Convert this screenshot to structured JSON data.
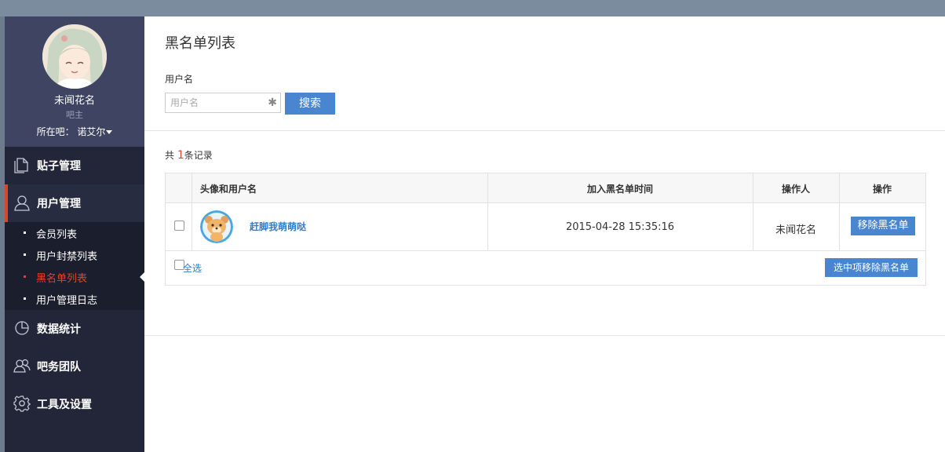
{
  "profile": {
    "name": "未闻花名",
    "role": "吧主",
    "bar_label": "所在吧：",
    "bar_name": "诺艾尔"
  },
  "nav": [
    {
      "label": "贴子管理",
      "icon": "document-icon"
    },
    {
      "label": "用户管理",
      "icon": "user-icon"
    },
    {
      "label": "数据统计",
      "icon": "pie-chart-icon"
    },
    {
      "label": "吧务团队",
      "icon": "team-icon"
    },
    {
      "label": "工具及设置",
      "icon": "gear-icon"
    }
  ],
  "subnav": [
    "会员列表",
    "用户封禁列表",
    "黑名单列表",
    "用户管理日志"
  ],
  "page": {
    "title": "黑名单列表"
  },
  "search": {
    "label": "用户名",
    "placeholder": "用户名",
    "clear_icon": "✱",
    "button": "搜索"
  },
  "records": {
    "prefix": "共",
    "count": "1",
    "suffix": "条记录"
  },
  "table": {
    "headers": [
      "头像和用户名",
      "加入黑名单时间",
      "操作人",
      "操作"
    ],
    "rows": [
      {
        "username": "赶脚我萌萌哒",
        "time": "2015-04-28 15:35:16",
        "operator": "未闻花名",
        "action": "移除黑名单"
      }
    ],
    "select_all": "全选",
    "bulk_action": "选中项移除黑名单"
  },
  "colors": {
    "accent": "#4a86d0",
    "active": "#d9472b",
    "sidebar": "#232638",
    "link": "#2e7bcf"
  }
}
